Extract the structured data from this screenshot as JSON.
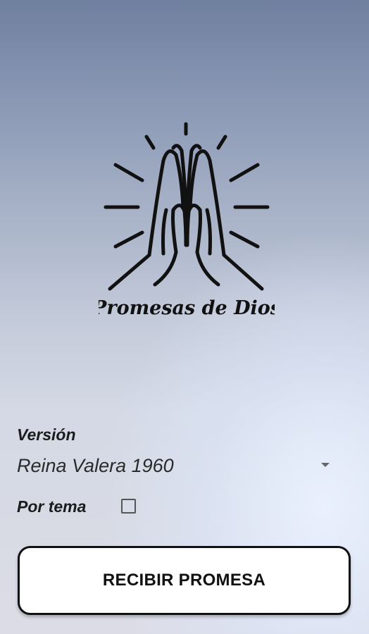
{
  "logo": {
    "title": "Promesas de Dios",
    "icon": "praying-hands-icon"
  },
  "form": {
    "version_label": "Versión",
    "version_value": "Reina Valera 1960",
    "topic_label": "Por tema",
    "topic_checked": false
  },
  "button": {
    "label": "RECIBIR PROMESA"
  }
}
